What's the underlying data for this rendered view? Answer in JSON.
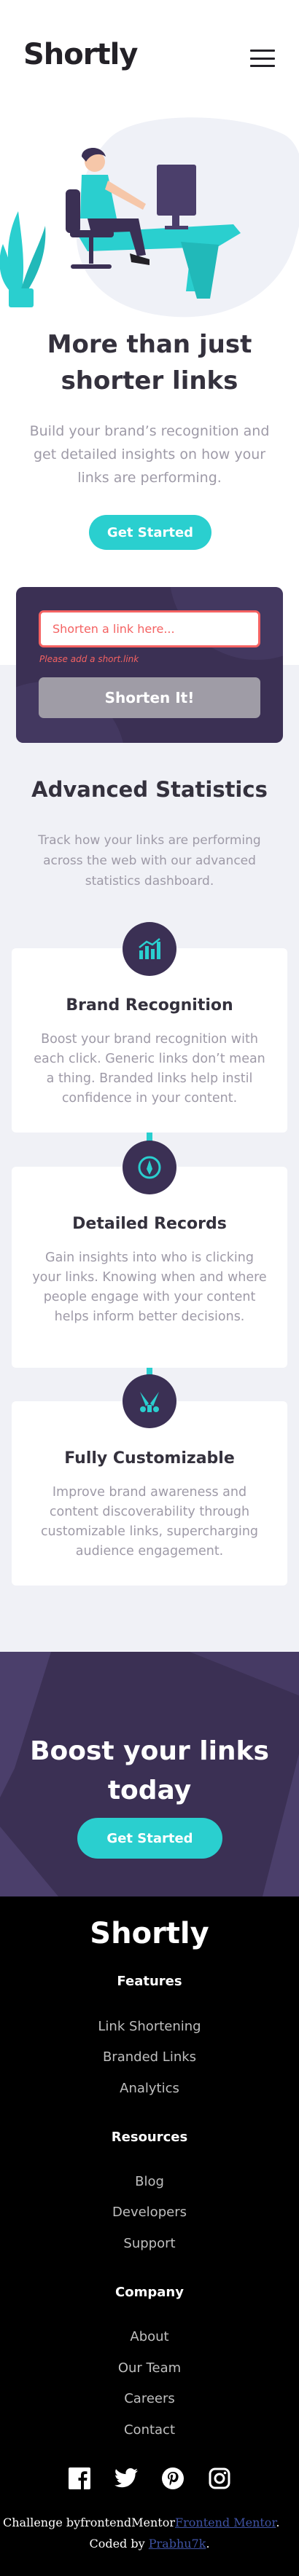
{
  "header": {
    "logo": "Shortly",
    "menu_icon": "hamburger-menu-icon"
  },
  "hero": {
    "title": "More than just shorter links",
    "subtitle": "Build your brand’s recognition and get detailed insights on how your links are performing.",
    "cta": "Get Started"
  },
  "shorten": {
    "placeholder": "Shorten a link here...",
    "error": "Please add a short.link",
    "button": "Shorten It!"
  },
  "stats": {
    "title": "Advanced Statistics",
    "subtitle": "Track how your links are performing across the web with our advanced statistics dashboard.",
    "cards": [
      {
        "icon": "brand-recognition-icon",
        "title": "Brand Recognition",
        "text": "Boost your brand recognition with each click. Generic links don’t mean a thing. Branded links help instil confidence in your content."
      },
      {
        "icon": "detailed-records-icon",
        "title": "Detailed Records",
        "text": "Gain insights into who is clicking your links. Knowing when and where people engage with your content helps inform better decisions."
      },
      {
        "icon": "fully-customizable-icon",
        "title": "Fully Customizable",
        "text": "Improve brand awareness and content discoverability through customizable links, supercharging audience engagement."
      }
    ]
  },
  "boost": {
    "title": "Boost your links today",
    "cta": "Get Started"
  },
  "footer": {
    "logo": "Shortly",
    "features": {
      "title": "Features",
      "links": [
        "Link Shortening",
        "Branded Links",
        "Analytics"
      ]
    },
    "resources": {
      "title": "Resources",
      "links": [
        "Blog",
        "Developers",
        "Support"
      ]
    },
    "company": {
      "title": "Company",
      "links": [
        "About",
        "Our Team",
        "Careers",
        "Contact"
      ]
    },
    "socials": [
      "facebook-icon",
      "twitter-icon",
      "pinterest-icon",
      "instagram-icon"
    ],
    "attribution": {
      "prefix": "Challenge by",
      "mentor_text": "frontendMentor",
      "mentor_link": "Frontend Mentor",
      "coded_prefix": "Coded by",
      "author": "Prabhu7k"
    }
  },
  "colors": {
    "cyan": "#2acfcf",
    "dark_violet": "#3b3054",
    "red": "#f46262",
    "grey_bg": "#f0f1f6"
  }
}
